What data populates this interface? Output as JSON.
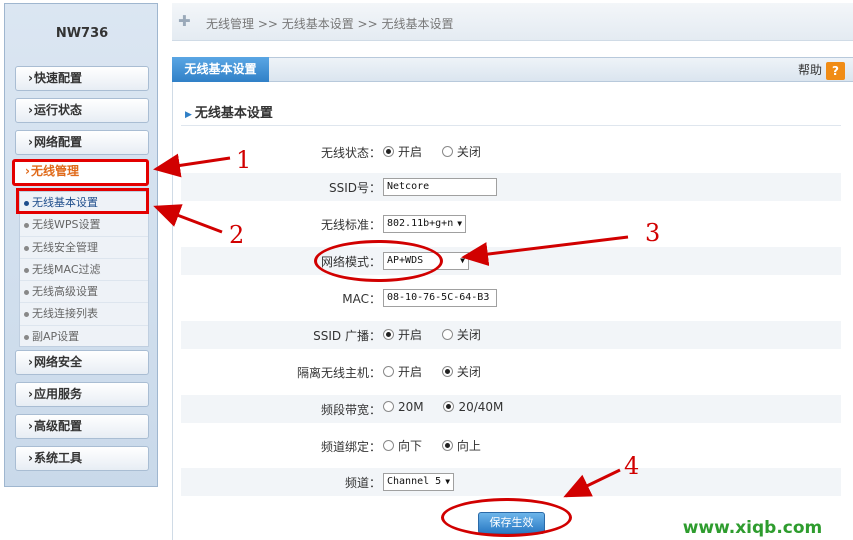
{
  "device": {
    "model": "NW736"
  },
  "breadcrumb": "无线管理 >> 无线基本设置 >> 无线基本设置",
  "sidebar": {
    "items": [
      {
        "arrow": "›",
        "label": "快速配置"
      },
      {
        "arrow": "›",
        "label": "运行状态"
      },
      {
        "arrow": "›",
        "label": "网络配置"
      },
      {
        "arrow": "›",
        "label": "无线管理"
      },
      {
        "arrow": "›",
        "label": "网络安全"
      },
      {
        "arrow": "›",
        "label": "应用服务"
      },
      {
        "arrow": "›",
        "label": "高级配置"
      },
      {
        "arrow": "›",
        "label": "系统工具"
      }
    ],
    "sub_items": [
      {
        "label": "无线基本设置"
      },
      {
        "label": "无线WPS设置"
      },
      {
        "label": "无线安全管理"
      },
      {
        "label": "无线MAC过滤"
      },
      {
        "label": "无线高级设置"
      },
      {
        "label": "无线连接列表"
      },
      {
        "label": "副AP设置"
      }
    ]
  },
  "panel": {
    "tab": "无线基本设置",
    "help_label": "帮助",
    "help_icon_text": "?",
    "section_title": "无线基本设置"
  },
  "form": {
    "wireless_status": {
      "label": "无线状态：",
      "on": "开启",
      "off": "关闭"
    },
    "ssid": {
      "label": "SSID号：",
      "value": "Netcore"
    },
    "standard": {
      "label": "无线标准：",
      "value": "802.11b+g+n"
    },
    "network_mode": {
      "label": "网络模式：",
      "value": "AP+WDS"
    },
    "mac": {
      "label": "MAC：",
      "value": "08-10-76-5C-64-B3"
    },
    "ssid_broadcast": {
      "label": "SSID 广播：",
      "on": "开启",
      "off": "关闭"
    },
    "isolate": {
      "label": "隔离无线主机：",
      "on": "开启",
      "off": "关闭"
    },
    "bandwidth": {
      "label": "频段带宽：",
      "opt1": "20M",
      "opt2": "20/40M"
    },
    "channel_bind": {
      "label": "频道绑定：",
      "opt1": "向下",
      "opt2": "向上"
    },
    "channel": {
      "label": "频道：",
      "value": "Channel 5"
    },
    "save_label": "保存生效"
  },
  "annotations": {
    "n1": "1",
    "n2": "2",
    "n3": "3",
    "n4": "4",
    "annotation_color": "#d10000"
  },
  "watermark": "www.xiqb.com"
}
